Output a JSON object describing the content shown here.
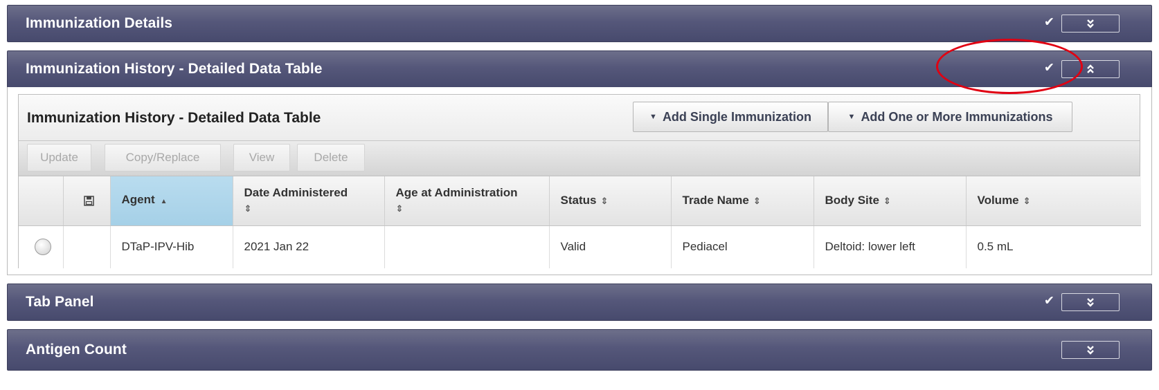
{
  "panels": {
    "immunization_details": {
      "title": "Immunization Details",
      "checked": true,
      "expanded": false
    },
    "immunization_history": {
      "title": "Immunization History - Detailed Data Table",
      "checked": true,
      "expanded": true
    },
    "tab_panel": {
      "title": "Tab Panel",
      "checked": true,
      "expanded": false
    },
    "antigen_count": {
      "title": "Antigen Count",
      "checked": false,
      "expanded": false
    }
  },
  "icons": {
    "check": "✔",
    "expand": "double-chevron-down-icon",
    "collapse": "double-chevron-up-icon",
    "save": "save-icon",
    "sort": "⇕",
    "sort_asc": "▲"
  },
  "table_panel": {
    "title": "Immunization History - Detailed Data Table",
    "add_single": "Add Single Immunization",
    "add_multiple": "Add One or More Immunizations",
    "caret": "▼"
  },
  "toolbar": {
    "update": "Update",
    "copy_replace": "Copy/Replace",
    "view": "View",
    "delete": "Delete"
  },
  "columns": {
    "agent": "Agent",
    "date_administered": "Date Administered",
    "age_at_administration": "Age at Administration",
    "status": "Status",
    "trade_name": "Trade Name",
    "body_site": "Body Site",
    "volume": "Volume"
  },
  "rows": [
    {
      "agent": "DTaP-IPV-Hib",
      "date_administered": "2021 Jan 22",
      "age_at_administration": "",
      "status": "Valid",
      "trade_name": "Pediacel",
      "body_site": "Deltoid: lower left",
      "volume": "0.5 mL"
    }
  ],
  "colors": {
    "header_bar": "#55577a",
    "sorted_column": "#a5d0e7",
    "annotation": "#e00012"
  }
}
